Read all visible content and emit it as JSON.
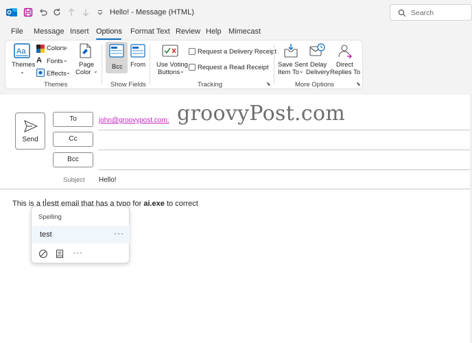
{
  "window": {
    "title": "Hello!  -  Message (HTML)",
    "search_placeholder": "Search"
  },
  "menu": {
    "items": [
      "File",
      "Message",
      "Insert",
      "Options",
      "Format Text",
      "Review",
      "Help",
      "Mimecast"
    ],
    "active": "Options"
  },
  "ribbon": {
    "themes": {
      "themes_label": "Themes",
      "colors_label": "Colors",
      "fonts_label": "Fonts",
      "effects_label": "Effects",
      "page_color_line1": "Page",
      "page_color_line2": "Color",
      "group_label": "Themes"
    },
    "show_fields": {
      "bcc_label": "Bcc",
      "from_label": "From",
      "group_label": "Show Fields"
    },
    "tracking": {
      "voting_line1": "Use Voting",
      "voting_line2": "Buttons",
      "delivery_receipt": "Request a Delivery Receipt",
      "read_receipt": "Request a Read Receipt",
      "group_label": "Tracking"
    },
    "more_options": {
      "save_sent_line1": "Save Sent",
      "save_sent_line2": "Item To",
      "delay_line1": "Delay",
      "delay_line2": "Delivery",
      "direct_line1": "Direct",
      "direct_line2": "Replies To",
      "group_label": "More Options"
    }
  },
  "compose": {
    "send_label": "Send",
    "to_label": "To",
    "cc_label": "Cc",
    "bcc_label": "Bcc",
    "to_value": "john@groovypost.com;",
    "subject_label": "Subject",
    "subject_value": "Hello!",
    "watermark": "groovyPost.com",
    "body": {
      "before_caret": "This is a ",
      "typo_part1": "t",
      "typo_part2": "estt",
      "middle": " email that has a typo for ",
      "bold": "ai.exe",
      "after": " to correct"
    }
  },
  "spelling_popup": {
    "header": "Spelling",
    "suggestion": "test",
    "more": "···"
  },
  "colors": {
    "accent": "#0f6cbd",
    "link": "#c026c0",
    "typo_underline": "#d13438"
  }
}
